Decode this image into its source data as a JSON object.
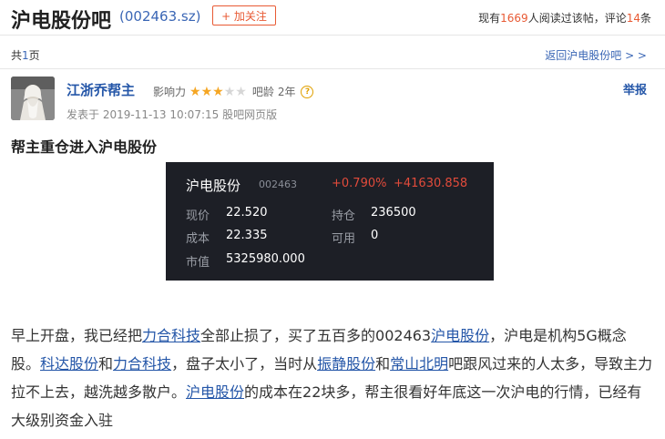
{
  "header": {
    "title": "沪电股份吧",
    "code": "(002463.sz)",
    "follow_label": "+ 加关注",
    "stats_prefix": "现有",
    "readers": "1669",
    "stats_mid": "人阅读过该帖，评论",
    "comments": "14",
    "stats_suffix": "条"
  },
  "pager": {
    "prefix": "共",
    "pages": "1",
    "suffix": "页",
    "back_link": "返回沪电股份吧 > >"
  },
  "post": {
    "author": "江浙乔帮主",
    "influence_label": "影响力",
    "rating": 3,
    "rating_max": 5,
    "age_label": "吧龄",
    "age": "2年",
    "report_label": "举报",
    "meta": "发表于 2019-11-13 10:07:15 股吧网页版",
    "title": "帮主重仓进入沪电股份"
  },
  "stock_card": {
    "name": "沪电股份",
    "code": "002463",
    "change_pct": "+0.790%",
    "change_amt": "+41630.858",
    "rows": [
      {
        "l1": "现价",
        "v1": "22.520",
        "l2": "持仓",
        "v2": "236500"
      },
      {
        "l1": "成本",
        "v1": "22.335",
        "l2": "可用",
        "v2": "0"
      },
      {
        "l1": "市值",
        "v1": "5325980.000",
        "l2": "",
        "v2": ""
      }
    ]
  },
  "content": {
    "t1": "早上开盘，我已经把",
    "link1": "力合科技",
    "t2": "全部止损了，买了五百多的002463",
    "link2": "沪电股份",
    "t3": "，沪电是机构5G概念股。",
    "link3": "科达股份",
    "t4": "和",
    "link4": "力合科技",
    "t5": "，盘子太小了，当时从",
    "link5": "振静股份",
    "t6": "和",
    "link6": "常山北明",
    "t7": "吧跟风过来的人太多，导致主力拉不上去，越洗越多散户。",
    "link7": "沪电股份",
    "t8": "的成本在22块多，帮主很看好年底这一次沪电的行情，已经有大级别资金入驻"
  }
}
